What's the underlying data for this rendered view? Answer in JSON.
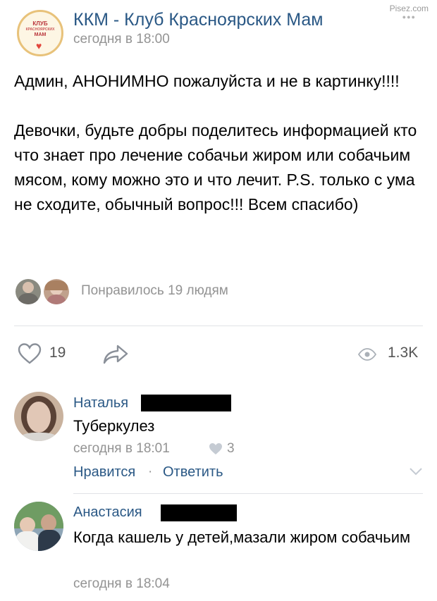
{
  "watermark": "Pisez.com",
  "post": {
    "author": "ККМ - Клуб Красноярских Мам",
    "avatar_text": [
      "КЛУБ",
      "КРАСНОЯРСКИХ",
      "МАМ"
    ],
    "time": "сегодня в 18:00",
    "text": "Админ, АНОНИМНО пожалуйста и не в картинку!!!!\n\nДевочки, будьте добры поделитесь информацией кто что знает про лечение собачьи жиром или собачьим мясом, кому можно это и что лечит. P.S. только с ума не сходите, обычный вопрос!!! Всем спасибо)",
    "liked_by": "Понравилось 19 людям",
    "likes": "19",
    "views": "1.3K"
  },
  "comments": [
    {
      "name": "Наталья",
      "text": "Туберкулез",
      "time": "сегодня в 18:01",
      "likes": "3",
      "like_action": "Нравится",
      "separator": "·",
      "reply_action": "Ответить"
    },
    {
      "name": "Анастасия",
      "text": "Когда кашель у детей,мазали жиром собачьим",
      "time": "сегодня в 18:04"
    }
  ],
  "colors": {
    "link": "#2a5885",
    "meta": "#939393"
  }
}
